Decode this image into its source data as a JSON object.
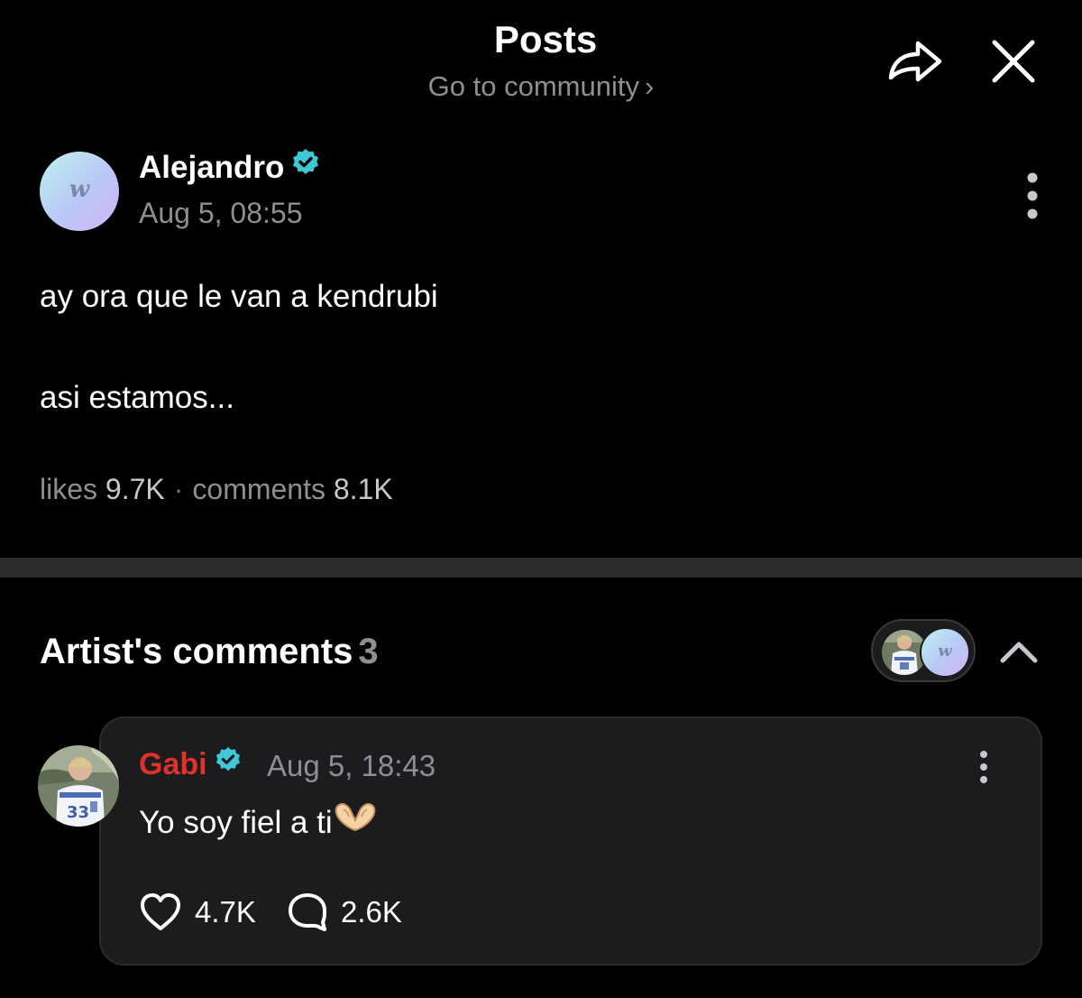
{
  "header": {
    "title": "Posts",
    "community_link": "Go to community",
    "chevron": "›"
  },
  "post": {
    "author": "Alejandro",
    "avatar_letter": "w",
    "timestamp": "Aug 5, 08:55",
    "lines": [
      "ay ora que le van a kendrubi",
      "asi estamos..."
    ],
    "stats": {
      "likes_label": "likes",
      "likes": "9.7K",
      "separator": "·",
      "comments_label": "comments",
      "comments": "8.1K"
    }
  },
  "artist_comments": {
    "title": "Artist's comments",
    "count": "3",
    "pill_avatar_letter": "w",
    "comment": {
      "author": "Gabi",
      "timestamp": "Aug 5, 18:43",
      "text": "Yo soy fiel a ti",
      "likes": "4.7K",
      "replies": "2.6K"
    }
  },
  "icons": {
    "share": "share-icon",
    "close": "close-icon",
    "more": "more-vertical-icon",
    "verified": "verified-badge-icon",
    "collapse": "chevron-up-icon",
    "heart": "heart-icon",
    "reply": "comment-bubble-icon",
    "heart_hands": "heart-hands-emoji"
  },
  "colors": {
    "background": "#000000",
    "card": "#1c1c1e",
    "divider": "#2c2c2e",
    "muted_text": "#8e8e93",
    "verified": "#3ec9d6",
    "artist_name": "#e0312b"
  }
}
